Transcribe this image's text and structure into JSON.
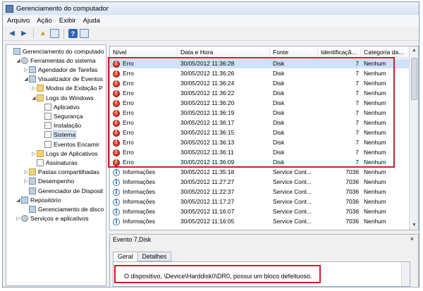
{
  "window": {
    "title": "Gerenciamento do computador"
  },
  "menu": [
    "Arquivo",
    "Ação",
    "Exibir",
    "Ajuda"
  ],
  "tree": [
    {
      "label": "Gerenciamento do computado",
      "icon": "computer-management-icon",
      "level": 0,
      "exp": ""
    },
    {
      "label": "Ferramentas do sistema",
      "icon": "tools-icon",
      "level": 1,
      "exp": "◢"
    },
    {
      "label": "Agendador de Tarefas",
      "icon": "clock-icon",
      "level": 2,
      "exp": "▷"
    },
    {
      "label": "Visualizador de Eventos",
      "icon": "event-viewer-icon",
      "level": 2,
      "exp": "◢"
    },
    {
      "label": "Modos de Exibição P",
      "icon": "folder-icon",
      "level": 3,
      "exp": "▷"
    },
    {
      "label": "Logs do Windows",
      "icon": "folder-icon",
      "level": 3,
      "exp": "◢"
    },
    {
      "label": "Aplicativo",
      "icon": "log-icon",
      "level": 4,
      "exp": ""
    },
    {
      "label": "Segurança",
      "icon": "log-icon",
      "level": 4,
      "exp": ""
    },
    {
      "label": "Instalação",
      "icon": "log-icon",
      "level": 4,
      "exp": ""
    },
    {
      "label": "Sistema",
      "icon": "log-icon",
      "level": 4,
      "exp": "",
      "selected": true
    },
    {
      "label": "Eventos Encamir",
      "icon": "log-icon",
      "level": 4,
      "exp": ""
    },
    {
      "label": "Logs de Aplicativos",
      "icon": "folder-icon",
      "level": 3,
      "exp": "▷"
    },
    {
      "label": "Assinaturas",
      "icon": "log-icon",
      "level": 3,
      "exp": ""
    },
    {
      "label": "Pastas compartilhadas",
      "icon": "shared-folder-icon",
      "level": 2,
      "exp": "▷"
    },
    {
      "label": "Desempenho",
      "icon": "performance-icon",
      "level": 2,
      "exp": "▷"
    },
    {
      "label": "Gerenciador de Disposit",
      "icon": "device-manager-icon",
      "level": 2,
      "exp": ""
    },
    {
      "label": "Repositório",
      "icon": "storage-icon",
      "level": 1,
      "exp": "◢"
    },
    {
      "label": "Gerenciamento de disco",
      "icon": "disk-icon",
      "level": 2,
      "exp": ""
    },
    {
      "label": "Serviços e aplicativos",
      "icon": "services-icon",
      "level": 1,
      "exp": "▷"
    }
  ],
  "columns": [
    "Nível",
    "Data e Hora",
    "Fonte",
    "Identificaçã...",
    "Categoria da..."
  ],
  "events": [
    {
      "level": "Erro",
      "type": "error",
      "datetime": "30/05/2012 11:36:28",
      "source": "Disk",
      "id": "7",
      "category": "Nenhum",
      "selected": true
    },
    {
      "level": "Erro",
      "type": "error",
      "datetime": "30/05/2012 11:36:26",
      "source": "Disk",
      "id": "7",
      "category": "Nenhum"
    },
    {
      "level": "Erro",
      "type": "error",
      "datetime": "30/05/2012 11:36:24",
      "source": "Disk",
      "id": "7",
      "category": "Nenhum"
    },
    {
      "level": "Erro",
      "type": "error",
      "datetime": "30/05/2012 11:36:22",
      "source": "Disk",
      "id": "7",
      "category": "Nenhum"
    },
    {
      "level": "Erro",
      "type": "error",
      "datetime": "30/05/2012 11:36:20",
      "source": "Disk",
      "id": "7",
      "category": "Nenhum"
    },
    {
      "level": "Erro",
      "type": "error",
      "datetime": "30/05/2012 11:36:19",
      "source": "Disk",
      "id": "7",
      "category": "Nenhum"
    },
    {
      "level": "Erro",
      "type": "error",
      "datetime": "30/05/2012 11:36:17",
      "source": "Disk",
      "id": "7",
      "category": "Nenhum"
    },
    {
      "level": "Erro",
      "type": "error",
      "datetime": "30/05/2012 11:36:15",
      "source": "Disk",
      "id": "7",
      "category": "Nenhum"
    },
    {
      "level": "Erro",
      "type": "error",
      "datetime": "30/05/2012 11:36:13",
      "source": "Disk",
      "id": "7",
      "category": "Nenhum"
    },
    {
      "level": "Erro",
      "type": "error",
      "datetime": "30/05/2012 11:36:11",
      "source": "Disk",
      "id": "7",
      "category": "Nenhum"
    },
    {
      "level": "Erro",
      "type": "error",
      "datetime": "30/05/2012 11:36:09",
      "source": "Disk",
      "id": "7",
      "category": "Nenhum"
    },
    {
      "level": "Informações",
      "type": "info",
      "datetime": "30/05/2012 11:35:18",
      "source": "Service Cont...",
      "id": "7036",
      "category": "Nenhum"
    },
    {
      "level": "Informações",
      "type": "info",
      "datetime": "30/05/2012 11:27:27",
      "source": "Service Cont...",
      "id": "7036",
      "category": "Nenhum"
    },
    {
      "level": "Informações",
      "type": "info",
      "datetime": "30/05/2012 11:22:37",
      "source": "Service Cont...",
      "id": "7036",
      "category": "Nenhum"
    },
    {
      "level": "Informações",
      "type": "info",
      "datetime": "30/05/2012 11:17:27",
      "source": "Service Cont...",
      "id": "7036",
      "category": "Nenhum"
    },
    {
      "level": "Informações",
      "type": "info",
      "datetime": "30/05/2012 11:16:07",
      "source": "Service Cont...",
      "id": "7036",
      "category": "Nenhum"
    },
    {
      "level": "Informações",
      "type": "info",
      "datetime": "30/05/2012 11:16:05",
      "source": "Service Cont...",
      "id": "7036",
      "category": "Nenhum"
    }
  ],
  "detail": {
    "title": "Evento 7,Disk",
    "close": "×",
    "tabs": [
      "Geral",
      "Detalhes"
    ],
    "message": "O dispositivo, \\Device\\Harddisk0\\DR0, possui um bloco defeituoso."
  },
  "colors": {
    "highlight_box": "#d01c2a",
    "selection": "#cde2fb"
  }
}
